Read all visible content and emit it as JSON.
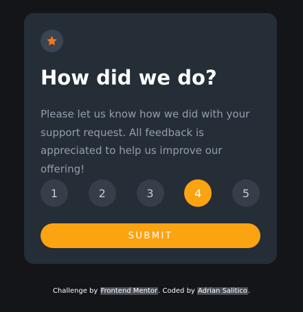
{
  "colors": {
    "page_background": "#131518",
    "card_background": "#252d37",
    "accent": "#fca311",
    "rating_background": "#363e4a",
    "text_muted": "#959eac"
  },
  "card": {
    "icon": "star-icon",
    "title": "How did we do?",
    "description": "Please let us know how we did with your support request. All feedback is appreciated to help us improve our offering!",
    "ratings": [
      "1",
      "2",
      "3",
      "4",
      "5"
    ],
    "selected_rating": "4",
    "submit_label": "SUBMIT"
  },
  "attribution": {
    "prefix": "Challenge by ",
    "challenge_link": "Frontend Mentor",
    "middle": ". Coded by ",
    "author_link": "Adrian Salitico",
    "suffix": "."
  }
}
